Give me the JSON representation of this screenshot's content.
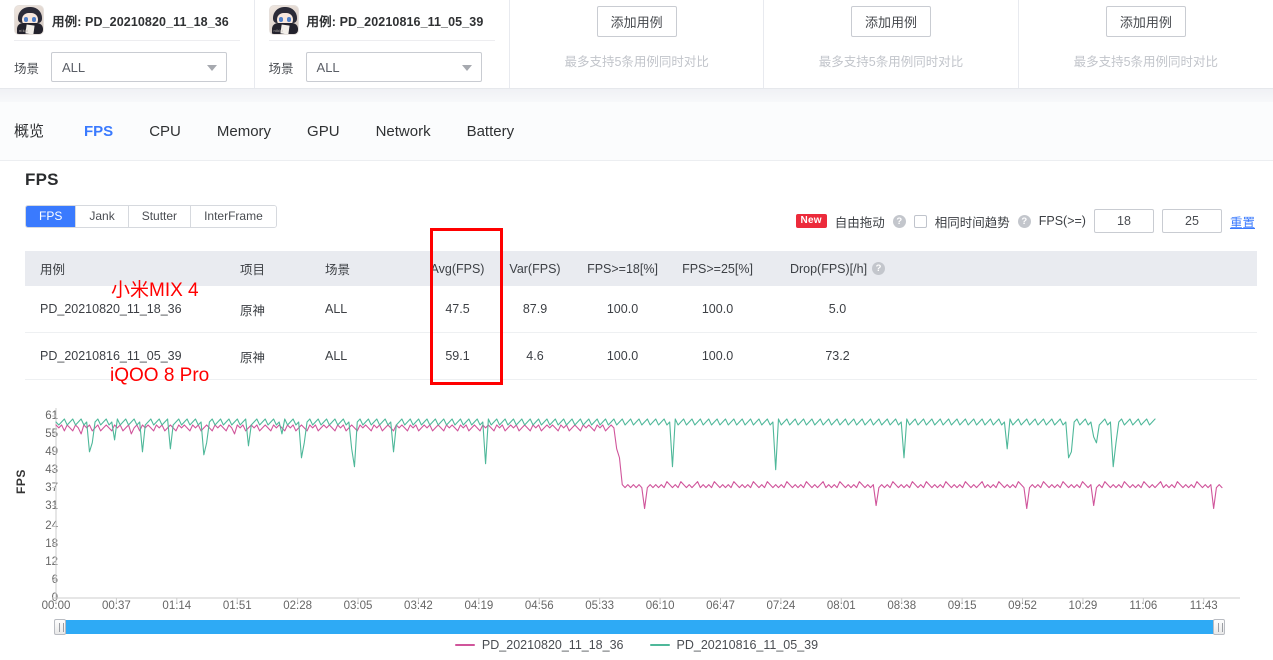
{
  "cards": {
    "case_label": "用例:",
    "scene_label": "场景",
    "scene_value": "ALL",
    "add_button": "添加用例",
    "add_hint": "最多支持5条用例同时对比",
    "items": [
      {
        "name": "PD_20210820_11_18_36"
      },
      {
        "name": "PD_20210816_11_05_39"
      }
    ]
  },
  "metric_tabs": [
    {
      "label": "概览",
      "active": false
    },
    {
      "label": "FPS",
      "active": true
    },
    {
      "label": "CPU",
      "active": false
    },
    {
      "label": "Memory",
      "active": false
    },
    {
      "label": "GPU",
      "active": false
    },
    {
      "label": "Network",
      "active": false
    },
    {
      "label": "Battery",
      "active": false
    }
  ],
  "section": {
    "title": "FPS",
    "subtabs": [
      {
        "label": "FPS",
        "active": true
      },
      {
        "label": "Jank",
        "active": false
      },
      {
        "label": "Stutter",
        "active": false
      },
      {
        "label": "InterFrame",
        "active": false
      }
    ]
  },
  "controls": {
    "new_badge": "New",
    "free_drag": "自由拖动",
    "same_time_trend": "相同时间趋势",
    "fps_ge_label": "FPS(>=)",
    "fps_threshold_1": "18",
    "fps_threshold_2": "25",
    "reset": "重置",
    "help_glyph": "?",
    "same_time_checked": false
  },
  "table": {
    "headers": [
      "用例",
      "项目",
      "场景",
      "Avg(FPS)",
      "Var(FPS)",
      "FPS>=18[%]",
      "FPS>=25[%]",
      "Drop(FPS)[/h]"
    ],
    "rows": [
      {
        "case": "PD_20210820_11_18_36",
        "project": "原神",
        "scene": "ALL",
        "avg": "47.5",
        "var": "87.9",
        "fps18": "100.0",
        "fps25": "100.0",
        "drop": "5.0"
      },
      {
        "case": "PD_20210816_11_05_39",
        "project": "原神",
        "scene": "ALL",
        "avg": "59.1",
        "var": "4.6",
        "fps18": "100.0",
        "fps25": "100.0",
        "drop": "73.2"
      }
    ]
  },
  "annotations": {
    "color": "#ff0000",
    "device_1": "小米MIX 4",
    "device_2": "iQOO 8 Pro"
  },
  "legend": [
    {
      "label": "PD_20210820_11_18_36",
      "color": "#d0559b"
    },
    {
      "label": "PD_20210816_11_05_39",
      "color": "#4fb89a"
    }
  ],
  "chart_data": {
    "type": "line",
    "title": "",
    "xlabel": "",
    "ylabel": "FPS",
    "ylim": [
      0,
      61
    ],
    "yticks": [
      0,
      6,
      12,
      18,
      24,
      31,
      37,
      43,
      49,
      55,
      61
    ],
    "xticks": [
      "00:00",
      "00:37",
      "01:14",
      "01:51",
      "02:28",
      "03:05",
      "03:42",
      "04:19",
      "04:56",
      "05:33",
      "06:10",
      "06:47",
      "07:24",
      "08:01",
      "08:38",
      "09:15",
      "09:52",
      "10:29",
      "11:06",
      "11:43"
    ],
    "grid": false,
    "legend_position": "bottom",
    "series": [
      {
        "name": "PD_20210820_11_18_36",
        "color": "#d0559b",
        "note": "小米MIX 4 — starts ~58fps, drops to ~38fps at 04:56 and stays there to end (~12:05)",
        "values": [
          58,
          57,
          58,
          56,
          58,
          57,
          56,
          58,
          57,
          55,
          58,
          57,
          58,
          56,
          57,
          58,
          56,
          57,
          58,
          57,
          56,
          58,
          57,
          58,
          56,
          57,
          58,
          55,
          57,
          58,
          56,
          58,
          57,
          58,
          57,
          56,
          58,
          57,
          58,
          56,
          57,
          58,
          57,
          56,
          58,
          57,
          58,
          57,
          56,
          58,
          57,
          58,
          56,
          57,
          58,
          57,
          56,
          58,
          57,
          58,
          57,
          56,
          58,
          57,
          55,
          58,
          57,
          58,
          56,
          57,
          58,
          57,
          58,
          56,
          57,
          58,
          57,
          56,
          58,
          57,
          58,
          57,
          56,
          58,
          57,
          58,
          56,
          57,
          58,
          57,
          56,
          58,
          57,
          58,
          56,
          57,
          58,
          57,
          58,
          57,
          56,
          58,
          57,
          58,
          56,
          57,
          58,
          57,
          56,
          58,
          57,
          58,
          57,
          56,
          58,
          57,
          58,
          56,
          57,
          58,
          57,
          56,
          58,
          57,
          58,
          57,
          56,
          58,
          57,
          58,
          56,
          57,
          58,
          57,
          58,
          56,
          57,
          58,
          57,
          56,
          58,
          57,
          58,
          57,
          56,
          58,
          57,
          58,
          56,
          57,
          58,
          57,
          56,
          58,
          57,
          58,
          57,
          56,
          58,
          57,
          58,
          56,
          57,
          58,
          57,
          58,
          56,
          57,
          58,
          57,
          56,
          58,
          57,
          58,
          56,
          57,
          58,
          57,
          58,
          57,
          56,
          58,
          57,
          58,
          56,
          57,
          58,
          57,
          56,
          58,
          57,
          58,
          57,
          56,
          58,
          57,
          58,
          56,
          57,
          58,
          57,
          50,
          47,
          38,
          37,
          38,
          37,
          38,
          37,
          38,
          37,
          30,
          37,
          38,
          37,
          38,
          37,
          38,
          37,
          39,
          38,
          37,
          38,
          37,
          39,
          38,
          37,
          38,
          37,
          38,
          39,
          37,
          38,
          37,
          38,
          37,
          39,
          38,
          37,
          38,
          37,
          38,
          37,
          39,
          38,
          37,
          38,
          37,
          38,
          37,
          39,
          38,
          37,
          38,
          37,
          39,
          38,
          37,
          38,
          37,
          38,
          37,
          39,
          38,
          37,
          38,
          37,
          38,
          37,
          39,
          38,
          37,
          38,
          37,
          38,
          39,
          37,
          38,
          37,
          38,
          37,
          39,
          38,
          37,
          38,
          37,
          38,
          37,
          39,
          38,
          37,
          38,
          37,
          38,
          31,
          37,
          38,
          37,
          38,
          37,
          39,
          38,
          37,
          38,
          37,
          38,
          37,
          39,
          38,
          37,
          38,
          37,
          39,
          38,
          37,
          38,
          37,
          38,
          37,
          39,
          38,
          37,
          38,
          37,
          38,
          37,
          39,
          38,
          37,
          38,
          37,
          38,
          39,
          37,
          38,
          37,
          38,
          37,
          39,
          38,
          37,
          38,
          37,
          38,
          37,
          39,
          38,
          37,
          30,
          37,
          38,
          37,
          38,
          37,
          39,
          38,
          37,
          38,
          37,
          38,
          37,
          39,
          38,
          37,
          38,
          37,
          38,
          37,
          39,
          38,
          37,
          38,
          31,
          37,
          38,
          37,
          39,
          38,
          37,
          38,
          37,
          38,
          37,
          39,
          38,
          37,
          38,
          37,
          38,
          37,
          39,
          38,
          37,
          38,
          37,
          38,
          39,
          37,
          38,
          37,
          38,
          37,
          39,
          38,
          37,
          38,
          37,
          38,
          37,
          39,
          38,
          37,
          38,
          37,
          38,
          30,
          37,
          38,
          37
        ]
      },
      {
        "name": "PD_20210816_11_05_39",
        "color": "#4fb89a",
        "note": "iQOO 8 Pro — mostly ~59fps with frequent dips to 43-52fps, series ends around 10:40",
        "values": [
          59,
          58,
          59,
          60,
          58,
          59,
          60,
          58,
          59,
          60,
          58,
          59,
          49,
          52,
          59,
          60,
          58,
          59,
          60,
          58,
          59,
          53,
          60,
          58,
          59,
          60,
          58,
          59,
          60,
          58,
          59,
          49,
          58,
          59,
          60,
          58,
          59,
          60,
          58,
          59,
          60,
          50,
          58,
          59,
          60,
          58,
          59,
          60,
          58,
          59,
          60,
          58,
          59,
          48,
          52,
          59,
          60,
          58,
          59,
          60,
          58,
          59,
          60,
          58,
          59,
          60,
          58,
          59,
          60,
          51,
          58,
          59,
          60,
          58,
          59,
          60,
          58,
          59,
          60,
          58,
          59,
          55,
          60,
          58,
          59,
          60,
          58,
          59,
          47,
          52,
          59,
          60,
          58,
          59,
          60,
          58,
          59,
          60,
          58,
          59,
          60,
          58,
          59,
          60,
          58,
          59,
          50,
          44,
          59,
          60,
          58,
          59,
          60,
          58,
          59,
          60,
          58,
          59,
          60,
          58,
          59,
          49,
          58,
          59,
          60,
          58,
          59,
          60,
          58,
          59,
          60,
          58,
          59,
          60,
          58,
          59,
          60,
          58,
          59,
          60,
          58,
          59,
          60,
          58,
          59,
          60,
          58,
          59,
          60,
          58,
          59,
          60,
          58,
          59,
          45,
          60,
          58,
          59,
          60,
          58,
          59,
          60,
          58,
          59,
          60,
          58,
          59,
          60,
          58,
          59,
          60,
          58,
          59,
          60,
          58,
          59,
          60,
          58,
          59,
          60,
          58,
          59,
          60,
          58,
          59,
          60,
          58,
          59,
          60,
          58,
          59,
          60,
          58,
          59,
          60,
          58,
          59,
          60,
          58,
          59,
          60,
          58,
          59,
          60,
          58,
          59,
          60,
          58,
          59,
          60,
          58,
          59,
          60,
          58,
          59,
          60,
          58,
          59,
          60,
          58,
          59,
          44,
          60,
          58,
          59,
          60,
          58,
          59,
          60,
          58,
          59,
          60,
          58,
          59,
          60,
          58,
          59,
          60,
          58,
          59,
          60,
          58,
          59,
          60,
          58,
          59,
          60,
          58,
          59,
          60,
          58,
          59,
          60,
          58,
          59,
          60,
          58,
          59,
          43,
          60,
          58,
          59,
          60,
          58,
          59,
          60,
          58,
          59,
          60,
          58,
          59,
          60,
          58,
          59,
          60,
          58,
          59,
          60,
          58,
          59,
          60,
          58,
          59,
          60,
          58,
          59,
          60,
          58,
          59,
          60,
          58,
          59,
          60,
          58,
          59,
          60,
          58,
          59,
          60,
          58,
          59,
          60,
          58,
          59,
          47,
          60,
          58,
          59,
          60,
          58,
          59,
          60,
          58,
          59,
          60,
          58,
          59,
          60,
          58,
          59,
          60,
          58,
          59,
          60,
          58,
          59,
          60,
          58,
          59,
          60,
          58,
          59,
          60,
          58,
          59,
          60,
          58,
          59,
          60,
          58,
          59,
          50,
          60,
          58,
          59,
          60,
          58,
          59,
          60,
          58,
          59,
          60,
          58,
          59,
          60,
          58,
          59,
          60,
          58,
          59,
          60,
          58,
          59,
          47,
          49,
          59,
          60,
          58,
          59,
          60,
          58,
          59,
          54,
          52,
          58,
          59,
          60,
          58,
          59,
          44,
          52,
          59,
          60,
          58,
          59,
          60,
          58,
          59,
          60,
          58,
          59,
          60,
          58,
          59,
          60
        ]
      }
    ]
  }
}
